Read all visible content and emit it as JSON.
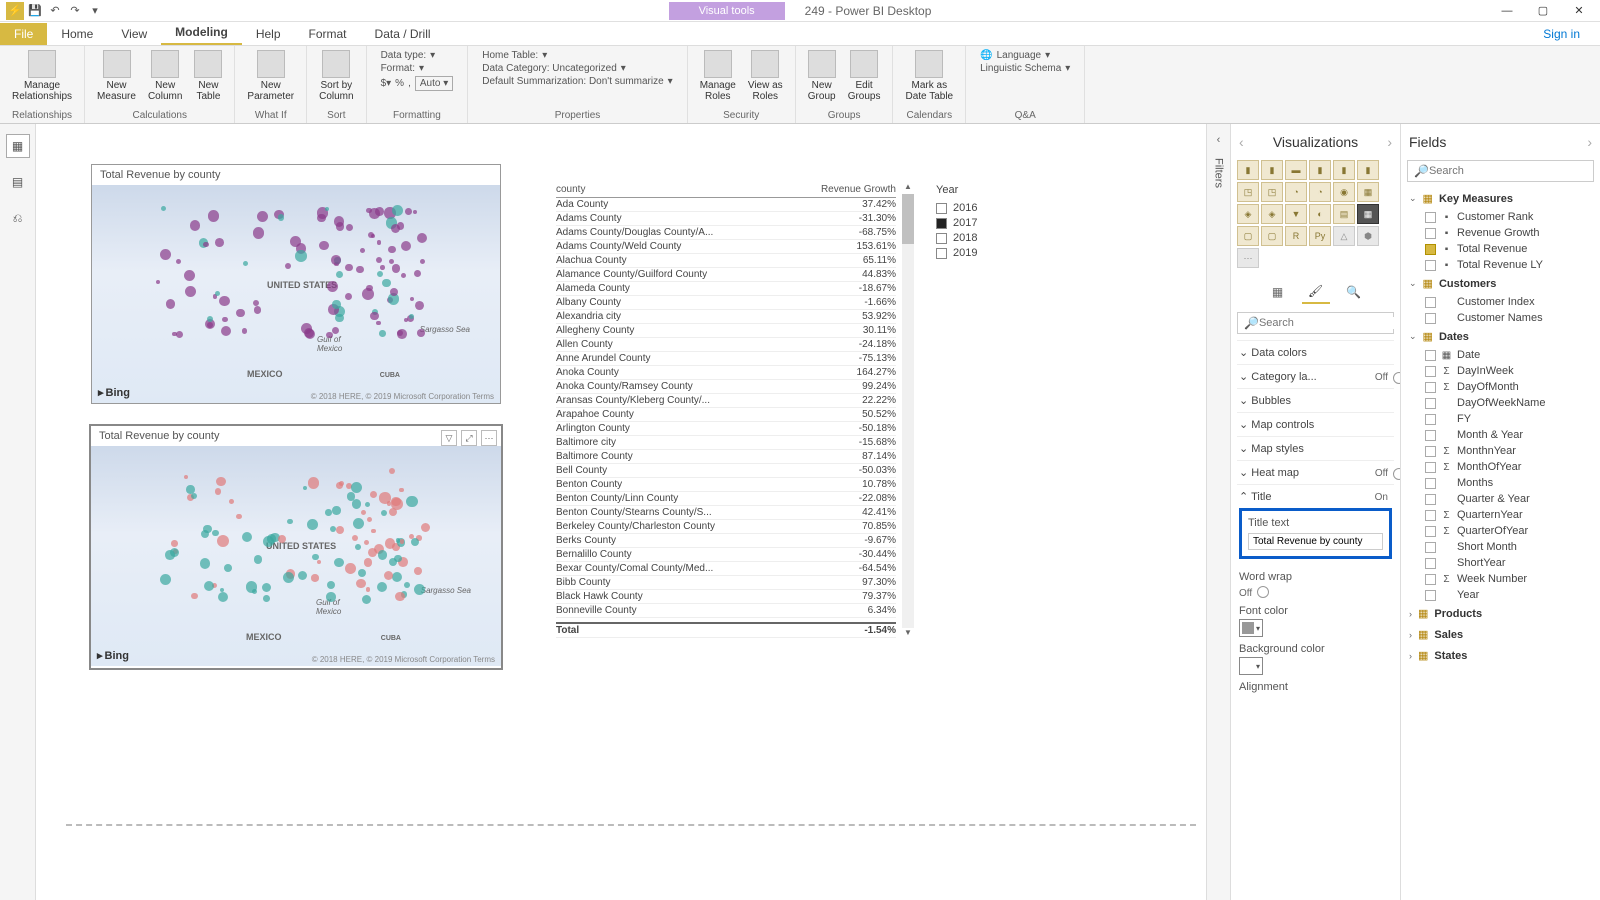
{
  "titlebar": {
    "visual_tools": "Visual tools",
    "window_title": "249 - Power BI Desktop",
    "signin": "Sign in"
  },
  "menu": {
    "tabs": [
      "File",
      "Home",
      "View",
      "Modeling",
      "Help",
      "Format",
      "Data / Drill"
    ],
    "active": "Modeling"
  },
  "ribbon": {
    "relationships": {
      "label": "Relationships",
      "manage": "Manage\nRelationships"
    },
    "calculations": {
      "label": "Calculations",
      "newmeasure": "New\nMeasure",
      "newcolumn": "New\nColumn",
      "newtable": "New\nTable"
    },
    "whatif": {
      "label": "What If",
      "newparam": "New\nParameter"
    },
    "sort": {
      "label": "Sort",
      "sortby": "Sort by\nColumn"
    },
    "formatting": {
      "label": "Formatting",
      "datatype": "Data type:",
      "format": "Format:",
      "auto": "Auto"
    },
    "properties": {
      "label": "Properties",
      "hometable": "Home Table:",
      "datacategory": "Data Category: Uncategorized",
      "summ": "Default Summarization: Don't summarize"
    },
    "security": {
      "label": "Security",
      "manageroles": "Manage\nRoles",
      "viewas": "View as\nRoles"
    },
    "groups": {
      "label": "Groups",
      "newgroup": "New\nGroup",
      "editgroups": "Edit\nGroups"
    },
    "calendars": {
      "label": "Calendars",
      "markdate": "Mark as\nDate Table"
    },
    "qa": {
      "label": "Q&A",
      "language": "Language",
      "schema": "Linguistic Schema"
    }
  },
  "canvas": {
    "map1_title": "Total Revenue by county",
    "map2_title": "Total Revenue by county",
    "bing": "Bing",
    "map_labels": {
      "us": "UNITED STATES",
      "mexico": "MEXICO",
      "cuba": "CUBA",
      "sargasso": "Sargasso Sea",
      "gulf": "Gulf of\nMexico"
    },
    "map_attr": "© 2018 HERE, © 2019 Microsoft Corporation   Terms"
  },
  "table": {
    "headers": [
      "county",
      "Revenue Growth"
    ],
    "rows": [
      [
        "Ada County",
        "37.42%"
      ],
      [
        "Adams County",
        "-31.30%"
      ],
      [
        "Adams County/Douglas County/A...",
        "-68.75%"
      ],
      [
        "Adams County/Weld County",
        "153.61%"
      ],
      [
        "Alachua County",
        "65.11%"
      ],
      [
        "Alamance County/Guilford County",
        "44.83%"
      ],
      [
        "Alameda County",
        "-18.67%"
      ],
      [
        "Albany County",
        "-1.66%"
      ],
      [
        "Alexandria city",
        "53.92%"
      ],
      [
        "Allegheny County",
        "30.11%"
      ],
      [
        "Allen County",
        "-24.18%"
      ],
      [
        "Anne Arundel County",
        "-75.13%"
      ],
      [
        "Anoka County",
        "164.27%"
      ],
      [
        "Anoka County/Ramsey County",
        "99.24%"
      ],
      [
        "Aransas County/Kleberg County/...",
        "22.22%"
      ],
      [
        "Arapahoe County",
        "50.52%"
      ],
      [
        "Arlington County",
        "-50.18%"
      ],
      [
        "Baltimore city",
        "-15.68%"
      ],
      [
        "Baltimore County",
        "87.14%"
      ],
      [
        "Bell County",
        "-50.03%"
      ],
      [
        "Benton County",
        "10.78%"
      ],
      [
        "Benton County/Linn County",
        "-22.08%"
      ],
      [
        "Benton County/Stearns County/S...",
        "42.41%"
      ],
      [
        "Berkeley County/Charleston County",
        "70.85%"
      ],
      [
        "Berks County",
        "-9.67%"
      ],
      [
        "Bernalillo County",
        "-30.44%"
      ],
      [
        "Bexar County/Comal County/Med...",
        "-64.54%"
      ],
      [
        "Bibb County",
        "97.30%"
      ],
      [
        "Black Hawk County",
        "79.37%"
      ],
      [
        "Bonneville County",
        "6.34%"
      ]
    ],
    "total": [
      "Total",
      "-1.54%"
    ]
  },
  "slicer": {
    "header": "Year",
    "items": [
      {
        "label": "2016",
        "checked": false
      },
      {
        "label": "2017",
        "checked": true
      },
      {
        "label": "2018",
        "checked": false
      },
      {
        "label": "2019",
        "checked": false
      }
    ]
  },
  "filters_label": "Filters",
  "vizpane": {
    "header": "Visualizations",
    "search_placeholder": "Search",
    "sections": {
      "datacolors": "Data colors",
      "categoryla": "Category la...",
      "bubbles": "Bubbles",
      "mapcontrols": "Map controls",
      "mapstyles": "Map styles",
      "heatmap": "Heat map",
      "title": "Title",
      "titletext_label": "Title text",
      "titletext_value": "Total Revenue by county",
      "wordwrap": "Word wrap",
      "fontcolor": "Font color",
      "bgcolor": "Background color",
      "alignment": "Alignment",
      "on": "On",
      "off": "Off"
    }
  },
  "fieldspane": {
    "header": "Fields",
    "search_placeholder": "Search",
    "tables": [
      {
        "name": "Key Measures",
        "open": true,
        "fields": [
          {
            "name": "Customer Rank",
            "checked": false,
            "type": "measure"
          },
          {
            "name": "Revenue Growth",
            "checked": false,
            "type": "measure"
          },
          {
            "name": "Total Revenue",
            "checked": true,
            "type": "measure"
          },
          {
            "name": "Total Revenue LY",
            "checked": false,
            "type": "measure"
          }
        ]
      },
      {
        "name": "Customers",
        "open": true,
        "fields": [
          {
            "name": "Customer Index",
            "checked": false,
            "type": "col"
          },
          {
            "name": "Customer Names",
            "checked": false,
            "type": "col"
          }
        ]
      },
      {
        "name": "Dates",
        "open": true,
        "fields": [
          {
            "name": "Date",
            "checked": false,
            "type": "hier"
          },
          {
            "name": "DayInWeek",
            "checked": false,
            "type": "sigma"
          },
          {
            "name": "DayOfMonth",
            "checked": false,
            "type": "sigma"
          },
          {
            "name": "DayOfWeekName",
            "checked": false,
            "type": "col"
          },
          {
            "name": "FY",
            "checked": false,
            "type": "col"
          },
          {
            "name": "Month & Year",
            "checked": false,
            "type": "col"
          },
          {
            "name": "MonthnYear",
            "checked": false,
            "type": "sigma"
          },
          {
            "name": "MonthOfYear",
            "checked": false,
            "type": "sigma"
          },
          {
            "name": "Months",
            "checked": false,
            "type": "col"
          },
          {
            "name": "Quarter & Year",
            "checked": false,
            "type": "col"
          },
          {
            "name": "QuarternYear",
            "checked": false,
            "type": "sigma"
          },
          {
            "name": "QuarterOfYear",
            "checked": false,
            "type": "sigma"
          },
          {
            "name": "Short Month",
            "checked": false,
            "type": "col"
          },
          {
            "name": "ShortYear",
            "checked": false,
            "type": "col"
          },
          {
            "name": "Week Number",
            "checked": false,
            "type": "sigma"
          },
          {
            "name": "Year",
            "checked": false,
            "type": "col"
          }
        ]
      },
      {
        "name": "Products",
        "open": false,
        "fields": []
      },
      {
        "name": "Sales",
        "open": false,
        "fields": []
      },
      {
        "name": "States",
        "open": false,
        "fields": []
      }
    ]
  }
}
